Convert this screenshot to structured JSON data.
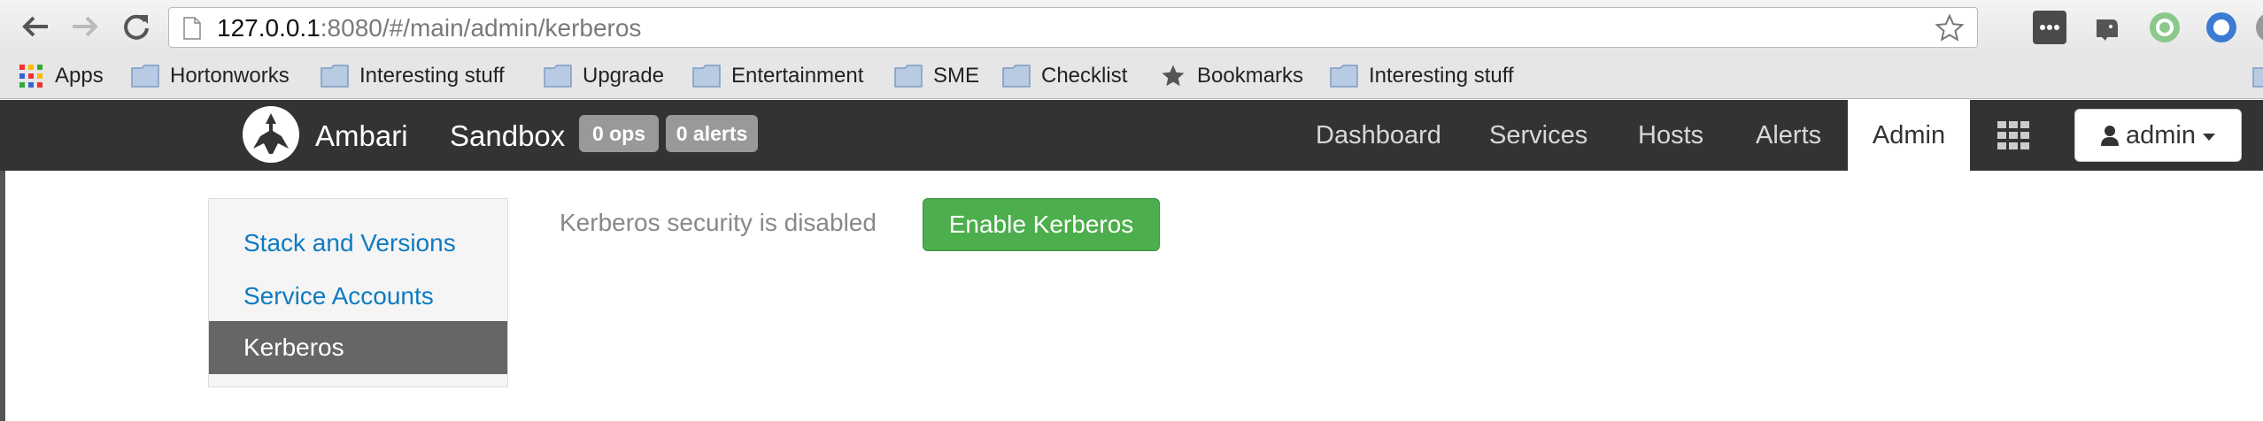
{
  "browser": {
    "url_host": "127.0.0.1",
    "url_rest": ":8080/#/main/admin/kerberos",
    "bookmarks": [
      {
        "label": "Apps",
        "icon": "apps-grid-icon"
      },
      {
        "label": "Hortonworks",
        "icon": "folder-icon"
      },
      {
        "label": "Interesting stuff",
        "icon": "folder-icon"
      },
      {
        "label": "Upgrade",
        "icon": "folder-icon"
      },
      {
        "label": "Entertainment",
        "icon": "folder-icon"
      },
      {
        "label": "SME",
        "icon": "folder-icon"
      },
      {
        "label": "Checklist",
        "icon": "folder-icon"
      },
      {
        "label": "Bookmarks",
        "icon": "star-icon"
      },
      {
        "label": "Interesting stuff",
        "icon": "folder-icon"
      }
    ]
  },
  "header": {
    "brand": "Ambari",
    "cluster": "Sandbox",
    "ops_badge": "0 ops",
    "alerts_badge": "0 alerts",
    "nav": [
      "Dashboard",
      "Services",
      "Hosts",
      "Alerts",
      "Admin"
    ],
    "user": "admin"
  },
  "sidebar": {
    "items": [
      {
        "label": "Stack and Versions",
        "active": false
      },
      {
        "label": "Service Accounts",
        "active": false
      },
      {
        "label": "Kerberos",
        "active": true
      }
    ]
  },
  "main": {
    "status_text": "Kerberos security is disabled",
    "enable_button": "Enable Kerberos"
  },
  "colors": {
    "header_bg": "#333333",
    "link": "#0f7bc1",
    "active_sidebar": "#666666",
    "success_button": "#4cae4c"
  }
}
